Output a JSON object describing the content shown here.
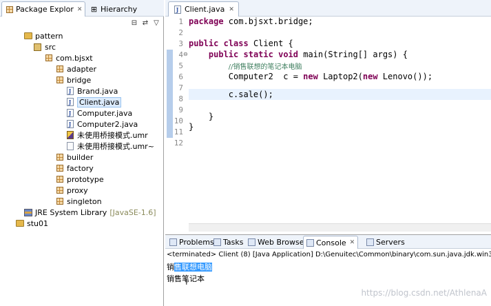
{
  "left_tabs": {
    "package_explorer": "Package Explor",
    "hierarchy": "Hierarchy"
  },
  "tree": {
    "pattern": "pattern",
    "src": "src",
    "com_bjsxt": "com.bjsxt",
    "adapter": "adapter",
    "bridge": "bridge",
    "brand_java": "Brand.java",
    "client_java": "Client.java",
    "computer_java": "Computer.java",
    "computer2_java": "Computer2.java",
    "umr_file": "未使用桥接模式.umr",
    "umr_file_tilde": "未使用桥接模式.umr~",
    "builder": "builder",
    "factory": "factory",
    "prototype": "prototype",
    "proxy": "proxy",
    "singleton": "singleton",
    "jre_lib": "JRE System Library",
    "jre_version": "[JavaSE-1.6]",
    "stu01": "stu01"
  },
  "editor": {
    "tab_label": "Client.java",
    "line_numbers": [
      "1",
      "2",
      "3",
      "4",
      "5",
      "6",
      "7",
      "8",
      "9",
      "10",
      "11",
      "12"
    ],
    "code": {
      "l1_kw": "package",
      "l1_rest": " com.bjsxt.bridge;",
      "l3_kw1": "public",
      "l3_kw2": "class",
      "l3_rest": " Client {",
      "l4_kw1": "public",
      "l4_kw2": "static",
      "l4_kw3": "void",
      "l4_rest": " main(String[] args) {",
      "l5_comment": "//销售联想的笔记本电脑",
      "l6_a": "Computer2  c = ",
      "l6_kw1": "new",
      "l6_b": " Laptop2(",
      "l6_kw2": "new",
      "l6_c": " Lenovo());",
      "l8": "c.sale();",
      "l10": "}",
      "l11": "}"
    }
  },
  "bottom_tabs": {
    "problems": "Problems",
    "tasks": "Tasks",
    "web_browser": "Web Browser",
    "console": "Console",
    "servers": "Servers"
  },
  "console": {
    "header": "<terminated> Client (8) [Java Application] D:\\Genuitec\\Common\\binary\\com.sun.java.jdk.win32.x86_1.6",
    "line1_prefix": "销",
    "line1_highlight": "售联想电脑",
    "line2": "销售笔记本",
    "cursor": "I"
  },
  "watermark": "https://blog.csdn.net/AthlenaA"
}
